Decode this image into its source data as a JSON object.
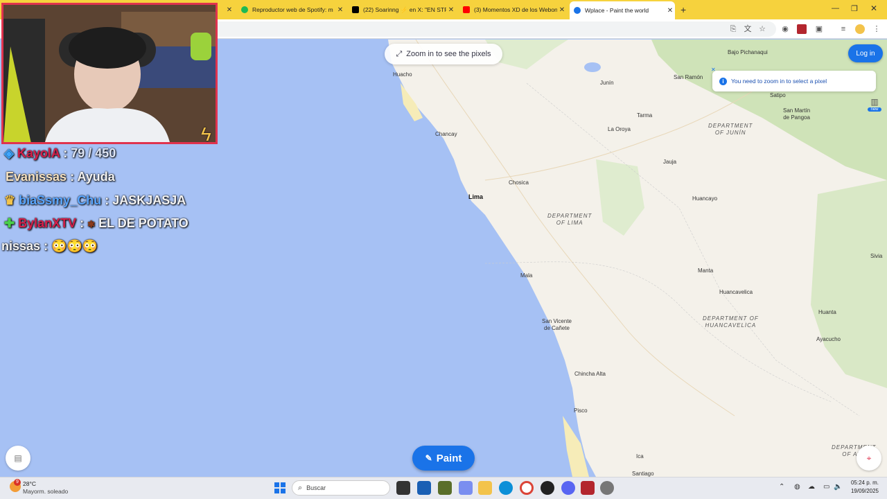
{
  "browser": {
    "tabs": [
      {
        "title": "Reproductor web de Spotify: m",
        "color": "#1db954"
      },
      {
        "title": "(22) Soarinng ⚡ en X: \"EN STR",
        "color": "#000000"
      },
      {
        "title": "(3) Momentos XD de los Webon",
        "color": "#ff0000"
      },
      {
        "title": "Wplace - Paint the world",
        "color": "#1a73e8"
      }
    ],
    "new_tab": "+"
  },
  "map": {
    "zoom_hint": "Zoom in to see the pixels",
    "login_label": "Log in",
    "toast": "You need to zoom in to select a pixel",
    "paint_label": "Paint",
    "new_badge": "new",
    "places": {
      "huacho": "Huacho",
      "chancay": "Chancay",
      "lima": "Lima",
      "chosica": "Chosica",
      "mala": "Mala",
      "san_vicente": "San Vicente\nde Cañete",
      "chincha": "Chincha Alta",
      "pisco": "Pisco",
      "ica": "Ica",
      "santiago": "Santiago",
      "junin": "Junín",
      "tarma": "Tarma",
      "la_oroya": "La Oroya",
      "jauja": "Jauja",
      "huancayo": "Huancayo",
      "manta": "Manta",
      "huancavelica": "Huancavelica",
      "huanta": "Huanta",
      "ayacucho": "Ayacucho",
      "san_ramon": "San Ramón",
      "bajo_pichanaqui": "Bajo Pichanaqui",
      "satipo": "Satipo",
      "san_martin": "San Martín\nde Pangoa",
      "sivia": "Sivia"
    },
    "departments": {
      "junin": "DEPARTMENT\nOF JUNÍN",
      "lima": "DEPARTMENT\nOF LIMA",
      "huancavelica": "DEPARTMENT OF\nHUANCAVELICA",
      "ayacucho": "DEPARTMENT\nOF AYA"
    }
  },
  "stream": {
    "chat": [
      {
        "user": "KayolA",
        "sep": ":",
        "msg": "79 / 450"
      },
      {
        "user": "Evanissas",
        "sep": ":",
        "msg": "Ayuda"
      },
      {
        "user": "biaSsmy_Chu",
        "sep": ":",
        "msg": "JASKJASJA"
      },
      {
        "user": "BylanXTV",
        "sep": ":",
        "msg": "EL DE POTATO"
      },
      {
        "user": "nissas",
        "sep": ":",
        "msg": "😳😳😳"
      }
    ]
  },
  "taskbar": {
    "weather_temp": "28°C",
    "weather_desc": "Mayorm. soleado",
    "weather_badge": "9",
    "search_placeholder": "Buscar",
    "time": "05:24 p. m.",
    "date": "19/09/2025"
  }
}
